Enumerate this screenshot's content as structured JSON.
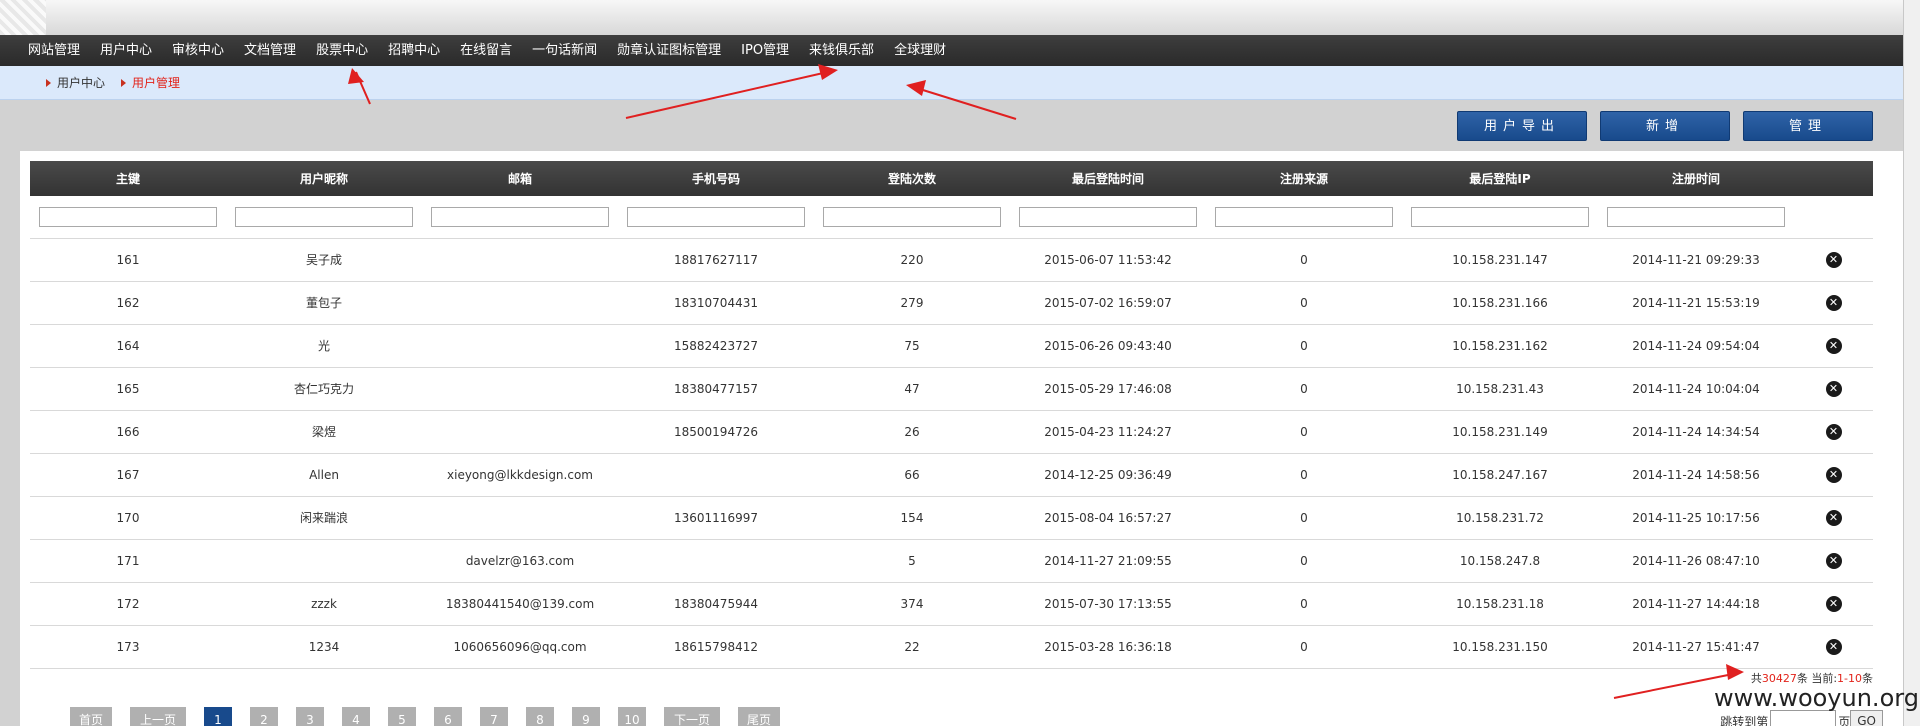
{
  "nav": {
    "items": [
      "网站管理",
      "用户中心",
      "审核中心",
      "文档管理",
      "股票中心",
      "招聘中心",
      "在线留言",
      "一句话新闻",
      "勋章认证图标管理",
      "IPO管理",
      "来钱俱乐部",
      "全球理财"
    ]
  },
  "breadcrumb": {
    "items": [
      "用户中心",
      "用户管理"
    ]
  },
  "toolbar": {
    "export_label": "用户导出",
    "add_label": "新增",
    "manage_label": "管理"
  },
  "table": {
    "columns": [
      "主键",
      "用户昵称",
      "邮箱",
      "手机号码",
      "登陆次数",
      "最后登陆时间",
      "注册来源",
      "最后登陆IP",
      "注册时间"
    ],
    "rows": [
      [
        "161",
        "吴子成",
        "",
        "18817627117",
        "220",
        "2015-06-07 11:53:42",
        "0",
        "10.158.231.147",
        "2014-11-21 09:29:33"
      ],
      [
        "162",
        "董包子",
        "",
        "18310704431",
        "279",
        "2015-07-02 16:59:07",
        "0",
        "10.158.231.166",
        "2014-11-21 15:53:19"
      ],
      [
        "164",
        "光",
        "",
        "15882423727",
        "75",
        "2015-06-26 09:43:40",
        "0",
        "10.158.231.162",
        "2014-11-24 09:54:04"
      ],
      [
        "165",
        "杏仁巧克力",
        "",
        "18380477157",
        "47",
        "2015-05-29 17:46:08",
        "0",
        "10.158.231.43",
        "2014-11-24 10:04:04"
      ],
      [
        "166",
        "梁煜",
        "",
        "18500194726",
        "26",
        "2015-04-23 11:24:27",
        "0",
        "10.158.231.149",
        "2014-11-24 14:34:54"
      ],
      [
        "167",
        "Allen",
        "xieyong@lkkdesign.com",
        "",
        "66",
        "2014-12-25 09:36:49",
        "0",
        "10.158.247.167",
        "2014-11-24 14:58:56"
      ],
      [
        "170",
        "闲来踹浪",
        "",
        "13601116997",
        "154",
        "2015-08-04 16:57:27",
        "0",
        "10.158.231.72",
        "2014-11-25 10:17:56"
      ],
      [
        "171",
        "",
        "davelzr@163.com",
        "",
        "5",
        "2014-11-27 21:09:55",
        "0",
        "10.158.247.8",
        "2014-11-26 08:47:10"
      ],
      [
        "172",
        "zzzk",
        "18380441540@139.com",
        "18380475944",
        "374",
        "2015-07-30 17:13:55",
        "0",
        "10.158.231.18",
        "2014-11-27 14:44:18"
      ],
      [
        "173",
        "1234",
        "1060656096@qq.com",
        "18615798412",
        "22",
        "2015-03-28 16:36:18",
        "0",
        "10.158.231.150",
        "2014-11-27 15:41:47"
      ]
    ],
    "delete_icon": "close-circle-icon"
  },
  "summary": {
    "prefix": "共",
    "total": "30427",
    "mid": "条 当前:",
    "range": "1-10",
    "suffix": "条"
  },
  "pager": {
    "first": "首页",
    "prev": "上一页",
    "pages": [
      "1",
      "2",
      "3",
      "4",
      "5",
      "6",
      "7",
      "8",
      "9",
      "10"
    ],
    "current": "1",
    "next": "下一页",
    "last": "尾页"
  },
  "jump": {
    "label": "跳转到第",
    "unit": "页",
    "go_label": "GO"
  },
  "watermark": "www.wooyun.org",
  "colors": {
    "nav_bg": "#333333",
    "crumb_bg": "#dbe9fb",
    "button_blue": "#184a8c",
    "accent_red": "#e2231a",
    "annotation_red": "#e02020"
  }
}
